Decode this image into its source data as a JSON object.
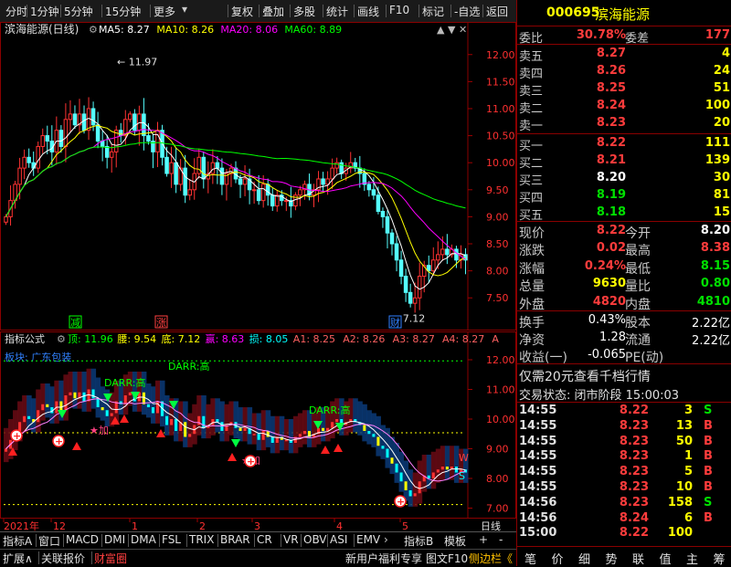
{
  "toolbar": {
    "left_items": [
      "分时",
      "1分钟",
      "5分钟",
      "15分钟",
      "更多"
    ],
    "more_arrow": "▾",
    "right_items": [
      "复权",
      "叠加",
      "多股",
      "统计",
      "画线",
      "F10",
      "标记",
      "-自选",
      "返回"
    ]
  },
  "main": {
    "title": "滨海能源(日线)",
    "ma_labels": [
      {
        "text": "MA5: 8.27",
        "color": "#ffffff"
      },
      {
        "text": "MA10: 8.26",
        "color": "#ffff00"
      },
      {
        "text": "MA20: 8.06",
        "color": "#ff00ff"
      },
      {
        "text": "MA60: 8.89",
        "color": "#00ff00"
      }
    ],
    "high_label": "11.97",
    "low_label": "7.12",
    "y_ticks": [
      "12.00",
      "11.50",
      "11.00",
      "10.50",
      "10.00",
      "9.50",
      "9.00",
      "8.50",
      "8.00",
      "7.50"
    ],
    "markers": [
      {
        "text": "减",
        "color": "#00ff00"
      },
      {
        "text": "涨",
        "color": "#ff4040"
      },
      {
        "text": "财",
        "color": "#3080ff"
      }
    ],
    "icons": [
      "gear-icon",
      "up-icon",
      "down-icon",
      "close-icon"
    ]
  },
  "indicator": {
    "title": "指标公式",
    "params": [
      {
        "text": "顶: 11.96",
        "color": "#00ff00"
      },
      {
        "text": "腰: 9.54",
        "color": "#ffff00"
      },
      {
        "text": "底: 7.12",
        "color": "#ffff00"
      },
      {
        "text": "赢: 8.63",
        "color": "#ff00ff"
      },
      {
        "text": "损: 8.05",
        "color": "#00ffff"
      },
      {
        "text": "A1: 8.25",
        "color": "#ff6060"
      },
      {
        "text": "A2: 8.26",
        "color": "#ff6060"
      },
      {
        "text": "A3: 8.27",
        "color": "#ff6060"
      },
      {
        "text": "A4: 8.27",
        "color": "#ff6060"
      },
      {
        "text": "A",
        "color": "#ff6060"
      }
    ],
    "sector": "板块: 广东包装",
    "darr_labels": [
      "DARR:高",
      "DARR:高",
      "DARR:高"
    ],
    "star_labels": [
      "★加",
      "★加"
    ],
    "y_ticks": [
      "12.00",
      "11.00",
      "10.00",
      "9.00",
      "8.00",
      "7.00"
    ],
    "side_labels": [
      "W",
      "S"
    ]
  },
  "xaxis": {
    "labels": [
      "2021年",
      "12",
      "1",
      "2",
      "3",
      "4",
      "5"
    ],
    "right_label": "日线"
  },
  "tabs1": [
    "指标A",
    "窗口",
    "MACD",
    "DMI",
    "DMA",
    "FSL",
    "TRIX",
    "BRAR",
    "CR",
    "VR",
    "OBV",
    "ASI",
    "EMV"
  ],
  "tabs1_right": [
    "指标B",
    "模板",
    "+",
    "-"
  ],
  "tabs2": [
    "扩展∧",
    "关联报价",
    "财富圈"
  ],
  "tabs2_right": [
    "新用户福利专享",
    "图文F10",
    "侧边栏《"
  ],
  "quote": {
    "code": "000695",
    "name": "滨海能源",
    "weibi_label": "委比",
    "weibi": "30.78%",
    "weicha_label": "委差",
    "weicha": "177",
    "sells": [
      {
        "label": "卖五",
        "price": "8.27",
        "vol": "4"
      },
      {
        "label": "卖四",
        "price": "8.26",
        "vol": "24"
      },
      {
        "label": "卖三",
        "price": "8.25",
        "vol": "51"
      },
      {
        "label": "卖二",
        "price": "8.24",
        "vol": "100"
      },
      {
        "label": "卖一",
        "price": "8.23",
        "vol": "20"
      }
    ],
    "buys": [
      {
        "label": "买一",
        "price": "8.22",
        "vol": "111",
        "pc": "red"
      },
      {
        "label": "买二",
        "price": "8.21",
        "vol": "139",
        "pc": "red"
      },
      {
        "label": "买三",
        "price": "8.20",
        "vol": "30",
        "pc": "white"
      },
      {
        "label": "买四",
        "price": "8.19",
        "vol": "81",
        "pc": "green"
      },
      {
        "label": "买五",
        "price": "8.18",
        "vol": "15",
        "pc": "green"
      }
    ],
    "stats": [
      {
        "l1": "现价",
        "v1": "8.22",
        "c1": "red",
        "l2": "今开",
        "v2": "8.20",
        "c2": "white"
      },
      {
        "l1": "涨跌",
        "v1": "0.02",
        "c1": "red",
        "l2": "最高",
        "v2": "8.38",
        "c2": "red"
      },
      {
        "l1": "涨幅",
        "v1": "0.24%",
        "c1": "red",
        "l2": "最低",
        "v2": "8.15",
        "c2": "green"
      },
      {
        "l1": "总量",
        "v1": "9630",
        "c1": "yellow",
        "l2": "量比",
        "v2": "0.80",
        "c2": "green"
      },
      {
        "l1": "外盘",
        "v1": "4820",
        "c1": "red",
        "l2": "内盘",
        "v2": "4810",
        "c2": "green"
      }
    ],
    "stats2": [
      {
        "l1": "换手",
        "v1": "0.43%",
        "c1": "white",
        "l2": "股本",
        "v2": "2.22亿",
        "c2": "white"
      },
      {
        "l1": "净资",
        "v1": "1.28",
        "c1": "white",
        "l2": "流通",
        "v2": "2.22亿",
        "c2": "white"
      },
      {
        "l1": "收益(一)",
        "v1": "-0.065",
        "c1": "white",
        "l2": "PE(动)",
        "v2": "",
        "c2": "white"
      }
    ],
    "promo": "仅需20元查看千档行情",
    "status": "交易状态: 闭市阶段 15:00:03"
  },
  "ticks": [
    {
      "t": "14:55",
      "p": "8.22",
      "v": "3",
      "f": "S"
    },
    {
      "t": "14:55",
      "p": "8.23",
      "v": "13",
      "f": "B"
    },
    {
      "t": "14:55",
      "p": "8.23",
      "v": "50",
      "f": "B"
    },
    {
      "t": "14:55",
      "p": "8.23",
      "v": "1",
      "f": "B"
    },
    {
      "t": "14:55",
      "p": "8.23",
      "v": "5",
      "f": "B"
    },
    {
      "t": "14:55",
      "p": "8.23",
      "v": "10",
      "f": "B"
    },
    {
      "t": "14:56",
      "p": "8.23",
      "v": "158",
      "f": "S"
    },
    {
      "t": "14:56",
      "p": "8.24",
      "v": "6",
      "f": "B"
    },
    {
      "t": "15:00",
      "p": "8.22",
      "v": "100",
      "f": ""
    }
  ],
  "right_tabs": [
    "笔",
    "价",
    "细",
    "势",
    "联",
    "值",
    "主",
    "筹"
  ],
  "chart_data": {
    "type": "candlestick",
    "ylim": [
      7.2,
      12.3
    ],
    "high": 11.97,
    "low": 7.12,
    "ma_last": {
      "MA5": 8.27,
      "MA10": 8.26,
      "MA20": 8.06,
      "MA60": 8.89
    },
    "close": [
      9.0,
      9.3,
      9.6,
      9.9,
      10.1,
      10.0,
      9.9,
      10.3,
      10.5,
      10.4,
      10.2,
      10.6,
      10.3,
      10.8,
      10.9,
      10.7,
      10.9,
      10.6,
      11.0,
      10.7,
      10.4,
      10.3,
      10.1,
      10.2,
      10.6,
      10.5,
      10.8,
      10.9,
      10.6,
      10.9,
      10.5,
      10.4,
      10.2,
      10.6,
      10.1,
      9.8,
      10.0,
      9.6,
      9.9,
      9.4,
      9.5,
      9.8,
      10.1,
      9.7,
      9.8,
      10.0,
      9.9,
      9.6,
      9.8,
      9.9,
      9.7,
      9.6,
      9.7,
      9.5,
      9.5,
      9.3,
      9.6,
      9.4,
      9.2,
      9.4,
      9.3,
      9.3,
      9.2,
      9.4,
      9.5,
      9.6,
      9.4,
      9.5,
      9.7,
      9.6,
      9.7,
      9.9,
      10.0,
      9.8,
      9.9,
      10.0,
      9.9,
      9.8,
      9.6,
      9.5,
      9.4,
      9.1,
      9.0,
      8.7,
      8.5,
      8.2,
      7.9,
      7.6,
      7.4,
      7.5,
      7.9,
      8.1,
      8.0,
      8.2,
      8.3,
      8.4,
      8.3,
      8.4,
      8.2,
      8.3,
      8.2
    ],
    "indicator_levels": {
      "top": 11.96,
      "waist": 9.54,
      "bottom": 7.12,
      "win": 8.63,
      "loss": 8.05
    }
  }
}
